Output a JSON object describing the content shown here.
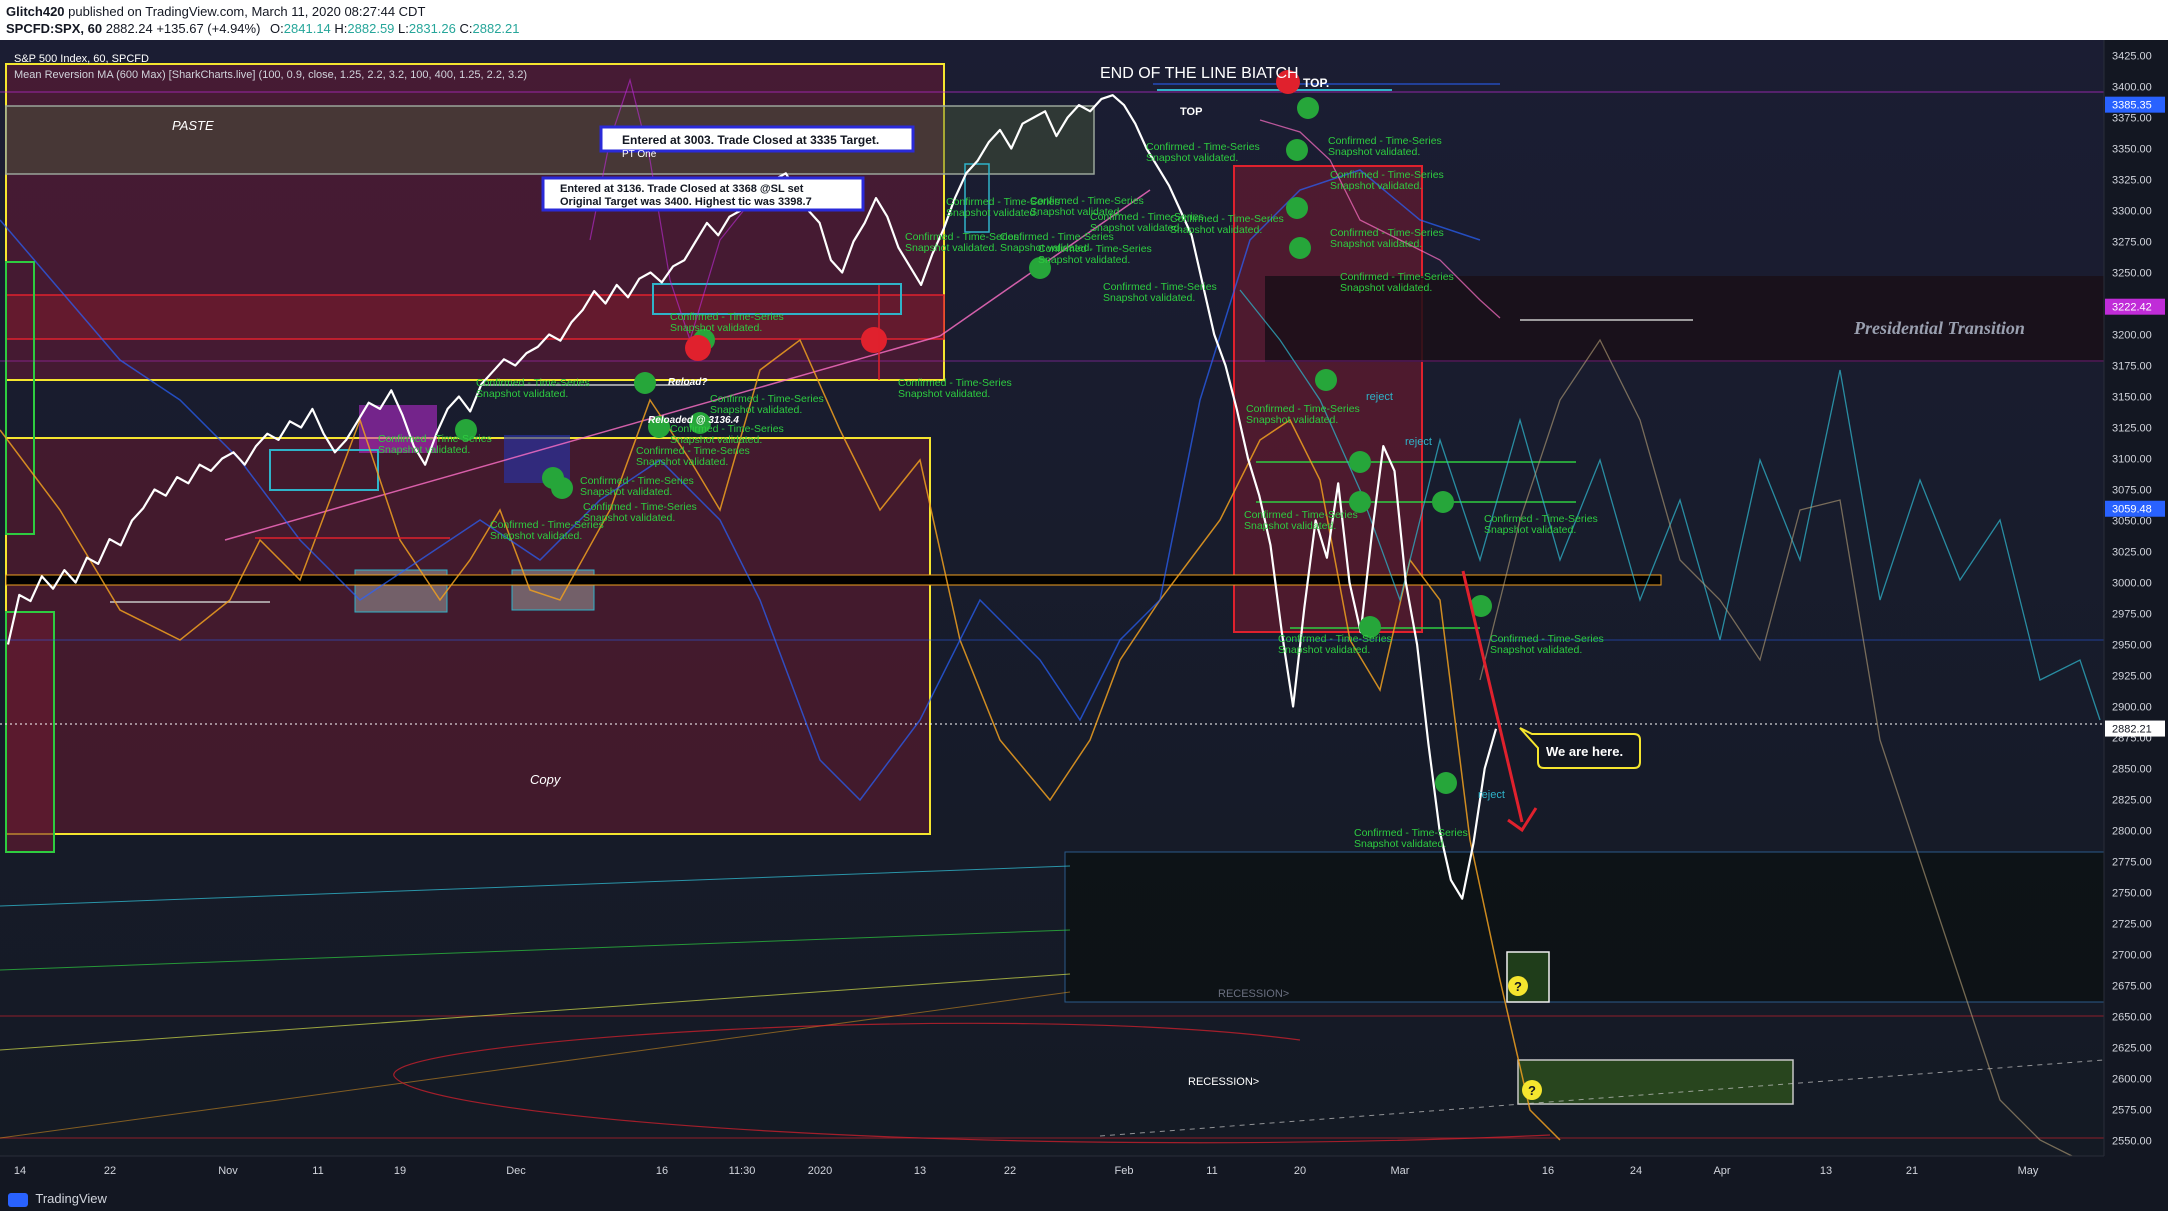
{
  "header": {
    "author": "Glitch420",
    "published_text": "published on TradingView.com, March 11, 2020 08:27:44 CDT",
    "symbol": "SPCFD:SPX, 60",
    "last": "2882.24",
    "change": "+135.67 (+4.94%)",
    "open_label": "O:",
    "open": "2841.14",
    "high_label": "H:",
    "high": "2882.59",
    "low_label": "L:",
    "low": "2831.26",
    "close_label": "C:",
    "close": "2882.21"
  },
  "legend": {
    "instrument": "S&P 500 Index, 60, SPCFD",
    "indicator": "Mean Reversion MA (600 Max) [SharkCharts.live] (100, 0.9, close, 1.25, 2.2, 3.2, 100, 400, 1.25, 2.2, 3.2)"
  },
  "footer": {
    "brand": "TradingView"
  },
  "colors": {
    "background": "#131722",
    "price": "#ffffff",
    "yellow": "#f5e52e",
    "green": "#2ecc40",
    "red": "#e0212d",
    "cyan": "#2fb3c9",
    "blue": "#2962ff",
    "magenta": "#c02cd8",
    "orange": "#f0a020"
  },
  "annotations": {
    "title": "END OF THE LINE BIATCH",
    "top1": "TOP.",
    "top2": "TOP",
    "presidential": "Presidential Transition",
    "paste": "PASTE",
    "copy": "Copy",
    "trade1": "Entered at 3003. Trade Closed  at 3335 Target.",
    "trade1b": "PT One",
    "trade2a": "Entered at 3136. Trade Closed at 3368 @SL  set",
    "trade2b": "Original Target was 3400. Highest tic was 3398.7",
    "we_are_here": "We are here.",
    "recession1": "RECESSION>",
    "recession2": "RECESSION>",
    "reload_q": "Reload?",
    "reloaded": "Reloaded @ 3136.4",
    "confirmed": "Confirmed - Time-Series Snapshot validated.",
    "reject": "reject",
    "question": "?"
  },
  "chart_data": {
    "type": "line",
    "ylim": [
      2537.5,
      3437.5
    ],
    "y_ticks": [
      3425,
      3400,
      3375,
      3350,
      3325,
      3300,
      3275,
      3250,
      3225,
      3200,
      3175,
      3150,
      3125,
      3100,
      3075,
      3050,
      3025,
      3000,
      2975,
      2950,
      2925,
      2900,
      2875,
      2850,
      2825,
      2800,
      2775,
      2750,
      2725,
      2700,
      2675,
      2650,
      2625,
      2600,
      2575,
      2550
    ],
    "y_tick_labels": [
      "3425.00",
      "3400.00",
      "3375.00",
      "3350.00",
      "3325.00",
      "3300.00",
      "3275.00",
      "3250.00",
      "3225.00",
      "3200.00",
      "3175.00",
      "3150.00",
      "3125.00",
      "3100.00",
      "3075.00",
      "3050.00",
      "3025.00",
      "3000.00",
      "2975.00",
      "2950.00",
      "2925.00",
      "2900.00",
      "2875.00",
      "2850.00",
      "2825.00",
      "2800.00",
      "2775.00",
      "2750.00",
      "2725.00",
      "2700.00",
      "2675.00",
      "2650.00",
      "2625.00",
      "2600.00",
      "2575.00",
      "2550.00"
    ],
    "x_tick_labels": [
      "14",
      "22",
      "Nov",
      "11",
      "19",
      "Dec",
      "16",
      "11:30",
      "2020",
      "13",
      "22",
      "Feb",
      "11",
      "20",
      "Mar",
      "16",
      "24",
      "Apr",
      "13",
      "21",
      "May"
    ],
    "price_badges": [
      {
        "value": 3385.35,
        "label": "3385.35",
        "color": "#2962ff"
      },
      {
        "value": 3222.42,
        "label": "3222.42",
        "color": "#c02cd8"
      },
      {
        "value": 3059.48,
        "label": "3059.48",
        "color": "#2962ff"
      },
      {
        "value": 2882.21,
        "label": "2882.21",
        "color": "#ffffff"
      }
    ],
    "series": [
      {
        "type": "price",
        "values": [
          2950,
          2990,
          2985,
          3005,
          2995,
          3010,
          3000,
          3020,
          3015,
          3035,
          3030,
          3050,
          3060,
          3075,
          3070,
          3085,
          3080,
          3095,
          3090,
          3100,
          3105,
          3095,
          3110,
          3120,
          3115,
          3130,
          3125,
          3140,
          3120,
          3105,
          3115,
          3130,
          3145,
          3140,
          3155,
          3135,
          3110,
          3095,
          3120,
          3140,
          3150,
          3138,
          3160,
          3170,
          3180,
          3175,
          3185,
          3190,
          3200,
          3195,
          3210,
          3220,
          3235,
          3225,
          3240,
          3230,
          3245,
          3250,
          3242,
          3255,
          3260,
          3275,
          3290,
          3280,
          3295,
          3300,
          3310,
          3320,
          3325,
          3330,
          3315,
          3300,
          3290,
          3260,
          3250,
          3275,
          3290,
          3310,
          3295,
          3270,
          3255,
          3240,
          3265,
          3285,
          3310,
          3330,
          3340,
          3355,
          3365,
          3350,
          3370,
          3375,
          3380,
          3360,
          3375,
          3385,
          3380,
          3390,
          3393,
          3385,
          3370,
          3350,
          3335,
          3320,
          3300,
          3280,
          3240,
          3200,
          3175,
          3140,
          3100,
          3070,
          3030,
          2960,
          2900,
          2980,
          3050,
          3020,
          3080,
          3000,
          2960,
          3040,
          3110,
          3090,
          3000,
          2950,
          2870,
          2800,
          2760,
          2745,
          2790,
          2850,
          2882
        ]
      }
    ]
  }
}
